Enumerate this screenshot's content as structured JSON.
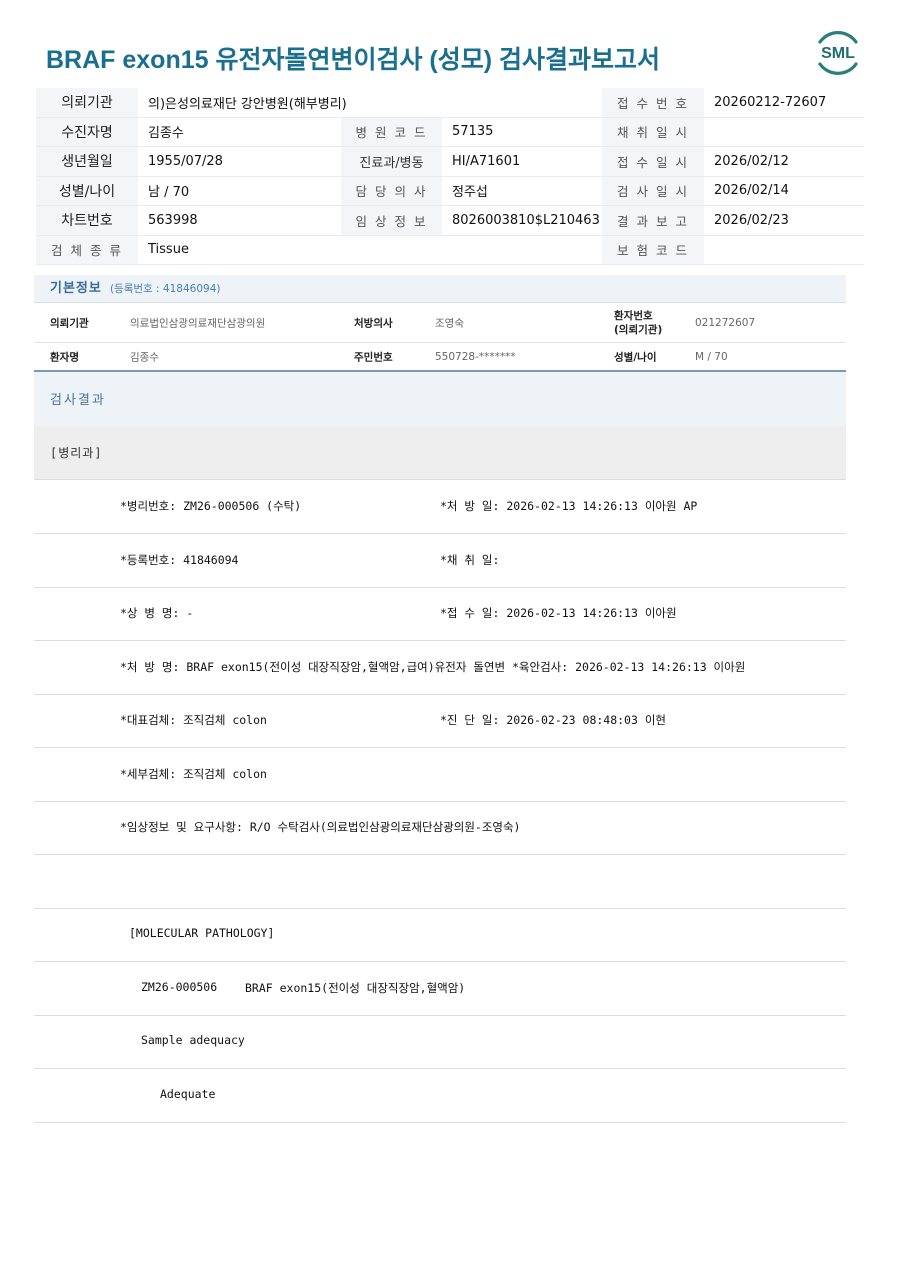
{
  "title": "BRAF exon15 유전자돌연변이검사 (성모) 검사결과보고서",
  "logo_text": "SML",
  "colors": {
    "title": "#1a6f8f",
    "logo": "#2a7e7e",
    "section_bg": "#eef3f8"
  },
  "header": {
    "r1": {
      "l1": "의뢰기관",
      "v1": "의)은성의료재단 강안병원(해부병리)",
      "l3": "접 수 번 호",
      "v3": "20260212-72607"
    },
    "r2": {
      "l1": "수진자명",
      "v1": "김종수",
      "l2": "병 원 코 드",
      "v2": "57135",
      "l3": "채 취 일 시",
      "v3": ""
    },
    "r3": {
      "l1": "생년월일",
      "v1": "1955/07/28",
      "l2": "진료과/병동",
      "v2": "HI/A71601",
      "l3": "접 수 일 시",
      "v3": "2026/02/12"
    },
    "r4": {
      "l1": "성별/나이",
      "v1": "남 / 70",
      "l2": "담 당 의 사",
      "v2": "정주섭",
      "l3": "검 사 일 시",
      "v3": "2026/02/14"
    },
    "r5": {
      "l1": "차트번호",
      "v1": "563998",
      "l2": "임 상 정 보",
      "v2": "8026003810$L210463",
      "l3": "결 과 보 고",
      "v3": "2026/02/23"
    },
    "r6": {
      "l1": "검 체 종 류",
      "v1": "Tissue",
      "l3": "보 험 코 드",
      "v3": ""
    }
  },
  "basic": {
    "title": "기본정보",
    "sub": "(등록번호 : 41846094)",
    "row1": {
      "k1": "의뢰기관",
      "v1": "의료법인삼광의료재단삼광의원",
      "k2": "처방의사",
      "v2": "조영숙",
      "k3a": "환자번호",
      "k3b": "(의뢰기관)",
      "v3": "021272607"
    },
    "row2": {
      "k1": "환자명",
      "v1": "김종수",
      "k2": "주민번호",
      "v2": "550728-*******",
      "k3": "성별/나이",
      "v3": "M / 70"
    }
  },
  "result": {
    "heading": "검사결과",
    "section": "[병리과]",
    "lines": {
      "l1a": "*병리번호: ZM26-000506 (수탁)",
      "l1b": "*처 방 일: 2026-02-13 14:26:13  이아원 AP",
      "l2a": "*등록번호: 41846094",
      "l2b": "*채 취 일:",
      "l3a": "*상 병 명: -",
      "l3b": "*접 수 일: 2026-02-13 14:26:13  이아원",
      "l4": "*처 방 명: BRAF exon15(전이성 대장직장암,혈액암,급여)유전자 돌연변  *육안검사: 2026-02-13 14:26:13  이아원",
      "l5a": "*대표검체: 조직검체 colon",
      "l5b": "*진 단 일: 2026-02-23 08:48:03  이현",
      "l6": "*세부검체: 조직검체 colon",
      "l7": "*임상정보 및 요구사항: R/O 수탁검사(의료법인삼광의료재단삼광의원-조영숙)",
      "l8": "",
      "l9": "[MOLECULAR PATHOLOGY]",
      "l10a": "ZM26-000506",
      "l10b": "BRAF exon15(전이성 대장직장암,혈액암)",
      "l11": "Sample adequacy",
      "l12": "Adequate"
    }
  }
}
